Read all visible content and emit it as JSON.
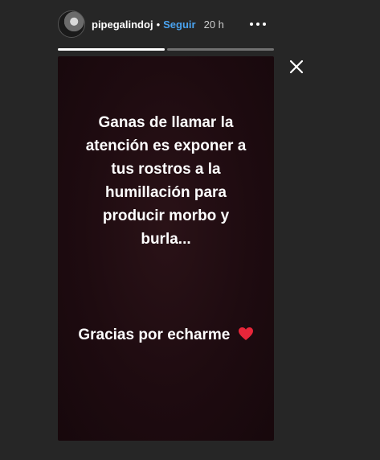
{
  "header": {
    "username": "pipegalindoj",
    "separator": "•",
    "follow_label": "Seguir",
    "time_ago": "20 h"
  },
  "progress": {
    "segments": [
      {
        "fill": 1.0
      },
      {
        "fill": 0.0
      }
    ]
  },
  "icons": {
    "more": "more-horizontal-icon",
    "close": "close-icon",
    "heart": "heart-icon"
  },
  "story": {
    "main_text": "Ganas de llamar la\natención es exponer a\ntus rostros a la\nhumillación para\nproducir morbo y\nburla...",
    "thanks_text": "Gracias por echarme"
  },
  "colors": {
    "background": "#262626",
    "follow": "#4aa3f0",
    "heart": "#e8263a"
  }
}
